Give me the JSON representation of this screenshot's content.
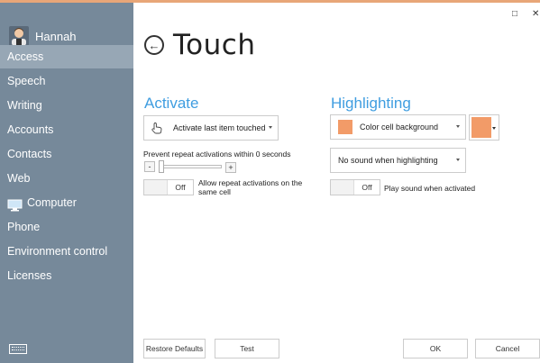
{
  "user": {
    "name": "Hannah"
  },
  "sidebar": {
    "items": [
      {
        "label": "Access"
      },
      {
        "label": "Speech"
      },
      {
        "label": "Writing"
      },
      {
        "label": "Accounts"
      },
      {
        "label": "Contacts"
      },
      {
        "label": "Web"
      },
      {
        "label": "Computer"
      },
      {
        "label": "Phone"
      },
      {
        "label": "Environment control"
      },
      {
        "label": "Licenses"
      }
    ],
    "active": "Access"
  },
  "window": {
    "restore_glyph": "□",
    "close_glyph": "✕"
  },
  "page": {
    "back_glyph": "←",
    "title": "Touch"
  },
  "activate": {
    "title": "Activate",
    "mode_value": "Activate last item touched",
    "repeat_label": "Prevent repeat activations within 0 seconds",
    "minus": "-",
    "plus": "+",
    "repeat_toggle_state": "Off",
    "repeat_toggle_label": "Allow repeat activations on the same cell"
  },
  "highlighting": {
    "title": "Highlighting",
    "style_value": "Color cell background",
    "color": "#f29b68",
    "sound_value": "No sound when highlighting",
    "sound_toggle_state": "Off",
    "sound_toggle_label": "Play sound when activated"
  },
  "footer": {
    "restore_defaults": "Restore Defaults",
    "test": "Test",
    "ok": "OK",
    "cancel": "Cancel"
  },
  "colors": {
    "accent": "#3f9de0",
    "sidebar": "#76899a",
    "sidebar_active": "#97a7b5",
    "swatch": "#f29b68"
  }
}
